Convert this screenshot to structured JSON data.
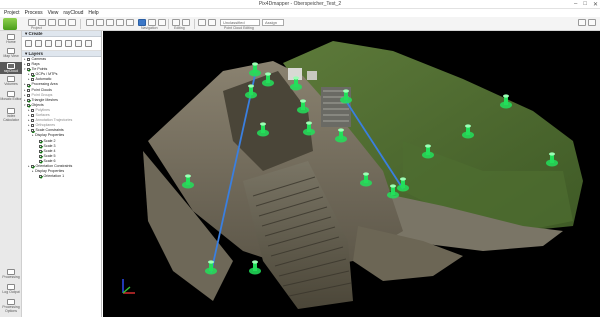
{
  "window": {
    "title": "Pix4Dmapper - Oberspeicher_Test_2"
  },
  "menu": [
    "Project",
    "Process",
    "View",
    "rayCloud",
    "Help"
  ],
  "ribbon": {
    "groups": [
      "Project",
      "Navigation",
      "Editing",
      "Point Cloud Editing"
    ],
    "class_combo": "Unclassified",
    "assign_button": "Assign",
    "unlabeled_small": [
      "New",
      "Save"
    ]
  },
  "sidebar": {
    "items": [
      {
        "label": "Home",
        "icon": "home-icon"
      },
      {
        "label": "Map View",
        "icon": "map-icon"
      },
      {
        "label": "rayCloud",
        "icon": "raycloud-icon",
        "active": true
      },
      {
        "label": "Volumes",
        "icon": "volumes-icon"
      },
      {
        "label": "Mosaic Editor",
        "icon": "mosaic-icon"
      },
      {
        "label": "Index Calculator",
        "icon": "index-icon"
      }
    ],
    "bottom_items": [
      {
        "label": "Processing",
        "icon": "processing-icon"
      },
      {
        "label": "Log Output",
        "icon": "log-icon"
      },
      {
        "label": "Processing Options",
        "icon": "options-icon"
      }
    ]
  },
  "panel": {
    "create_title": "Create",
    "layers_title": "Layers",
    "layers": [
      {
        "label": "Cameras",
        "level": 0,
        "checked": false
      },
      {
        "label": "Rays",
        "level": 0,
        "checked": false
      },
      {
        "label": "Tie Points",
        "level": 0,
        "checked": true,
        "expanded": true
      },
      {
        "label": "GCPs / MTPs",
        "level": 1,
        "checked": true
      },
      {
        "label": "Automatic",
        "level": 1,
        "checked": false
      },
      {
        "label": "Processing Area",
        "level": 0,
        "checked": true
      },
      {
        "label": "Point Clouds",
        "level": 0,
        "checked": false
      },
      {
        "label": "Point Groups",
        "level": 0,
        "checked": false,
        "dim": true
      },
      {
        "label": "Triangle Meshes",
        "level": 0,
        "checked": true
      },
      {
        "label": "Objects",
        "level": 0,
        "checked": true,
        "expanded": true
      },
      {
        "label": "Polylines",
        "level": 1,
        "checked": false,
        "dim": true
      },
      {
        "label": "Surfaces",
        "level": 1,
        "checked": false,
        "dim": true
      },
      {
        "label": "Annotation Trajectories",
        "level": 1,
        "checked": false,
        "dim": true
      },
      {
        "label": "Orthoplanes",
        "level": 1,
        "checked": false,
        "dim": true
      },
      {
        "label": "Scale Constraints",
        "level": 1,
        "checked": true
      },
      {
        "label": "Display Properties",
        "level": 2,
        "checked": null
      },
      {
        "label": "Scale 2",
        "level": 3,
        "checked": true
      },
      {
        "label": "Scale 3",
        "level": 3,
        "checked": true
      },
      {
        "label": "Scale 4",
        "level": 3,
        "checked": true
      },
      {
        "label": "Scale 5",
        "level": 3,
        "checked": true
      },
      {
        "label": "Scale 6",
        "level": 3,
        "checked": true
      },
      {
        "label": "Orientation Constraints",
        "level": 1,
        "checked": true
      },
      {
        "label": "Display Properties",
        "level": 2,
        "checked": null
      },
      {
        "label": "Orientation 1",
        "level": 3,
        "checked": true
      }
    ]
  },
  "viewport": {
    "accent_green": "#22e05a",
    "line_blue": "#3a7fe0",
    "axis_colors": {
      "x": "#e03030",
      "y": "#30c030",
      "z": "#3050ff"
    }
  }
}
